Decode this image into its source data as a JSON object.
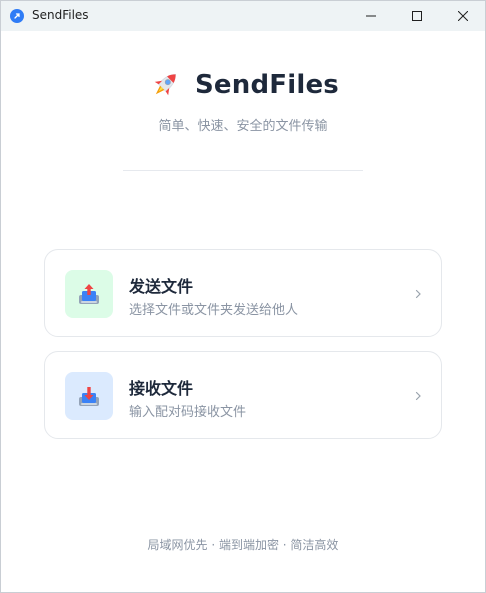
{
  "window": {
    "title": "SendFiles",
    "icons": {
      "app": "sendfiles-app-icon",
      "minimize": "minimize-icon",
      "maximize": "maximize-icon",
      "close": "close-icon"
    }
  },
  "hero": {
    "brand": "SendFiles",
    "logo_icon": "rocket-icon",
    "subtitle": "简单、快速、安全的文件传输"
  },
  "actions": [
    {
      "title": "发送文件",
      "description": "选择文件或文件夹发送给他人",
      "icon": "upload-tray-icon",
      "accent_bg": "#dcfce7"
    },
    {
      "title": "接收文件",
      "description": "输入配对码接收文件",
      "icon": "download-tray-icon",
      "accent_bg": "#dbeafe"
    }
  ],
  "footer": {
    "text": "局域网优先 · 端到端加密 · 简洁高效"
  },
  "colors": {
    "titlebar_bg": "#eef3f5",
    "brand_text": "#1e293b",
    "muted_text": "#8a94a3",
    "accent_blue": "#2f7cf6"
  }
}
